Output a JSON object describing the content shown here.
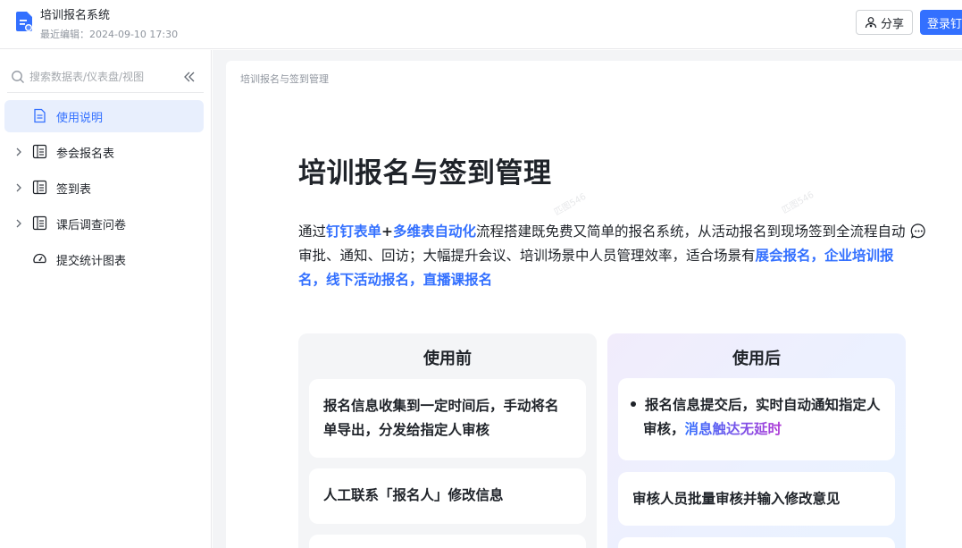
{
  "header": {
    "title": "培训报名系统",
    "last_edited": "最近编辑：2024-09-10 17:30",
    "share_label": "分享",
    "login_label": "登录钉钉"
  },
  "sidebar": {
    "search_placeholder": "搜索数据表/仪表盘/视图",
    "items": [
      {
        "label": "使用说明",
        "icon": "doc-icon",
        "active": true,
        "expandable": false
      },
      {
        "label": "参会报名表",
        "icon": "table-icon",
        "active": false,
        "expandable": true
      },
      {
        "label": "签到表",
        "icon": "table-icon",
        "active": false,
        "expandable": true
      },
      {
        "label": "课后调查问卷",
        "icon": "table-icon",
        "active": false,
        "expandable": true
      },
      {
        "label": "提交统计图表",
        "icon": "dashboard-icon",
        "active": false,
        "expandable": false
      }
    ]
  },
  "doc": {
    "breadcrumb": "培训报名与签到管理",
    "title": "培训报名与签到管理",
    "intro": {
      "t1": "通过",
      "h1": "钉钉表单",
      "t2": "+",
      "h2": "多维表自动化",
      "t3": "流程搭建既免费又简单的报名系统，从活动报名到现场签到全流程自动审批、通知、回访；大幅提升会议、培训场景中人员管理效率，适合场景有",
      "h3": "展会报名",
      "t4": "，",
      "h4": "企业培训报名",
      "t5": "，",
      "h5": "线下活动报名",
      "t6": "，",
      "h6": "直播课报名"
    },
    "before": {
      "heading": "使用前",
      "item1": "报名信息收集到一定时间后，手动将名单导出，分发给指定人审核",
      "item2": "人工联系「报名人」修改信息"
    },
    "after": {
      "heading": "使用后",
      "item1_text": "报名信息提交后，实时自动通知指定人审核，",
      "item1_highlight": "消息触达无延时",
      "item2": "审核人员批量审核并输入修改意见"
    },
    "watermark": "匹图546"
  },
  "colors": {
    "accent": "#3370ff",
    "active_bg": "#e8effd",
    "content_bg": "#f3f4f6"
  }
}
